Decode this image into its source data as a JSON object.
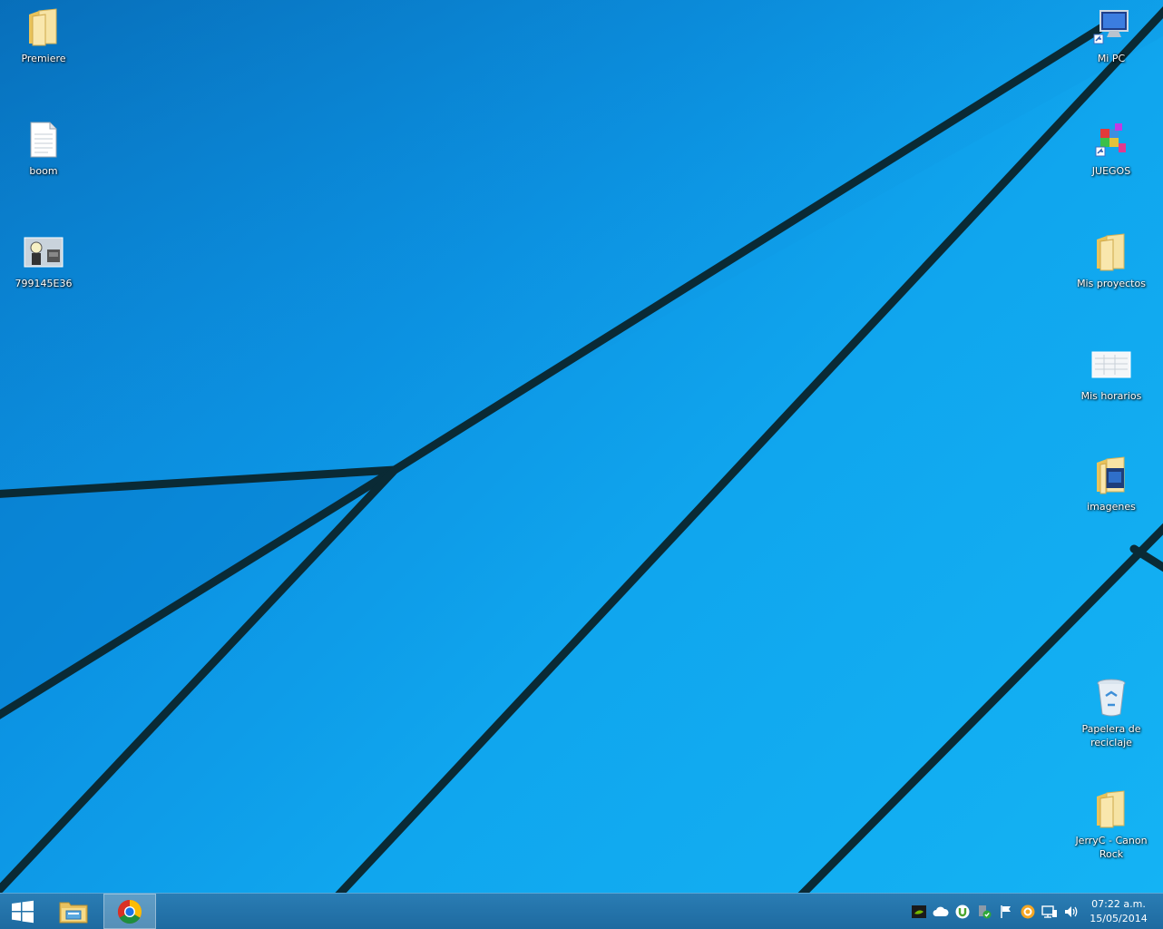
{
  "desktop": {
    "icons_left": [
      {
        "label": "Premiere",
        "icon": "folder-icon"
      },
      {
        "label": "boom",
        "icon": "text-file-icon"
      },
      {
        "label": "799145E36",
        "icon": "image-file-icon"
      }
    ],
    "icons_right": [
      {
        "label": "Mi PC",
        "icon": "computer-icon"
      },
      {
        "label": "JUEGOS",
        "icon": "games-icon"
      },
      {
        "label": "Mis proyectos",
        "icon": "folder-icon"
      },
      {
        "label": "Mis horarios",
        "icon": "image-file-icon"
      },
      {
        "label": "imagenes",
        "icon": "folder-icon"
      },
      {
        "label": "Papelera de reciclaje",
        "icon": "recycle-bin-icon"
      },
      {
        "label": "JerryC - Canon Rock",
        "icon": "folder-icon"
      }
    ]
  },
  "taskbar": {
    "pinned": [
      {
        "name": "start",
        "icon": "windows-logo-icon"
      },
      {
        "name": "file-explorer",
        "icon": "file-explorer-icon"
      },
      {
        "name": "chrome",
        "icon": "chrome-icon"
      }
    ],
    "tray_icons": [
      "nvidia-icon",
      "onedrive-icon",
      "utorrent-icon",
      "antivirus-icon",
      "action-center-flag-icon",
      "avast-icon",
      "network-icon",
      "volume-icon"
    ],
    "clock": {
      "time": "07:22 a.m.",
      "date": "15/05/2014"
    }
  },
  "colors": {
    "wallpaper_dark": "#0a7fd0",
    "wallpaper_light": "#14b3f4",
    "taskbar": "#1e6aa0",
    "folder": "#f3d46d"
  }
}
